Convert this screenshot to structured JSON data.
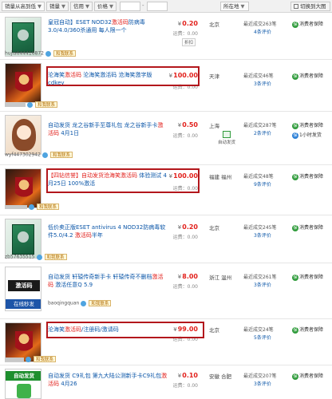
{
  "toolbar": {
    "sort_label": "销量从高到低",
    "sales_label": "销量",
    "credit_label": "信用",
    "price_label": "价格",
    "price_min": "",
    "price_max": "",
    "location_label": "所在地",
    "mode_label": "切换到大图",
    "sort_arrow": "▼",
    "dash": "-"
  },
  "listings": [
    {
      "title_parts": [
        "皇冠自动】ESET NOD32",
        "激活码",
        "防病毒3.0/4.0/360杀通用 每人限一个"
      ],
      "seller": "hujia644416872",
      "contact": "和我联系",
      "price": "0.20",
      "shipping": "运费：0.00",
      "discount": "折扣",
      "location": "北京",
      "deal": "最近成交263笔",
      "reviews": "4条评价",
      "protect1": "消费者保障",
      "protect2": "",
      "ziti": ""
    },
    {
      "title_parts": [
        "沦海笑",
        "激活码",
        " 沦海笑激活码 沧海笑激字版cdkey"
      ],
      "seller": "",
      "contact": "和我联系",
      "price": "100.00",
      "shipping": "运费：0.00",
      "discount": "",
      "location": "天津",
      "deal": "最近成交46笔",
      "reviews": "3条评价",
      "protect1": "消费者保障",
      "protect2": "",
      "ziti": ""
    },
    {
      "title_parts": [
        "自动发货 龙之谷新手至尊礼包 龙之谷新手卡",
        "激活码",
        " 4月1日"
      ],
      "seller": "wyf447302942",
      "contact": "和我联系",
      "price": "0.50",
      "shipping": "运费：0.00",
      "discount": "",
      "location": "上海",
      "deal": "最近成交287笔",
      "reviews": "2条评价",
      "protect1": "消费者保障",
      "protect2": "1小时发货",
      "ziti": "自动发货"
    },
    {
      "title_parts": [
        "【四钻信誉】自动发货沧海笑",
        "激活码",
        " 体验测试 4月25日 100%激活"
      ],
      "seller": "",
      "contact": "和我联系",
      "price": "100.00",
      "shipping": "运费：0.00",
      "discount": "",
      "location": "福建 福州",
      "deal": "最近成交48笔",
      "reviews": "9条评价",
      "protect1": "消费者保障",
      "protect2": "",
      "ziti": ""
    },
    {
      "title_parts": [
        "低价卖正版ESET antivirus 4 NOD32防病毒软件5.0/4.2 ",
        "激活码",
        "半年"
      ],
      "seller": "zb57635515",
      "contact": "和我联系",
      "price": "0.20",
      "shipping": "运费：0.00",
      "discount": "",
      "location": "北京",
      "deal": "最近成交245笔",
      "reviews": "3条评价",
      "protect1": "消费者保障",
      "protect2": "",
      "ziti": ""
    },
    {
      "title_parts": [
        "自动发货 轩辕传奇新手卡 轩辕传奇不删档",
        "激活码",
        " 激活任意Q 5.9"
      ],
      "seller": "baoqingquan",
      "contact": "和我联系",
      "price": "8.00",
      "shipping": "运费：0.00",
      "discount": "",
      "location": "浙江 温州",
      "deal": "最近成交261笔",
      "reviews": "3条评价",
      "protect1": "消费者保障",
      "protect2": "",
      "ziti": ""
    },
    {
      "title_parts": [
        "沦海笑",
        "激活码",
        "/注册码/激请码"
      ],
      "seller": "",
      "contact": "和我联系",
      "price": "99.00",
      "shipping": "运费：0.00",
      "discount": "",
      "location": "北京",
      "deal": "最近成交24笔",
      "reviews": "5条评价",
      "protect1": "消费者保障",
      "protect2": "",
      "ziti": ""
    },
    {
      "title_parts": [
        "自动发货 C9礼包 第九大陆公测新手卡C9礼包",
        "激活码",
        " 4月26"
      ],
      "seller": "",
      "contact": "",
      "price": "0.10",
      "shipping": "运费：0.00",
      "discount": "",
      "location": "安徽 合肥",
      "deal": "最近成交207笔",
      "reviews": "3条评价",
      "protect1": "消费者保障",
      "protect2": "",
      "ziti": ""
    }
  ],
  "thumbs": {
    "act_text": "激活码",
    "act_bar": "在线秒发",
    "auto_top": "自动发货"
  },
  "yen": "¥",
  "protect_icon": "保"
}
